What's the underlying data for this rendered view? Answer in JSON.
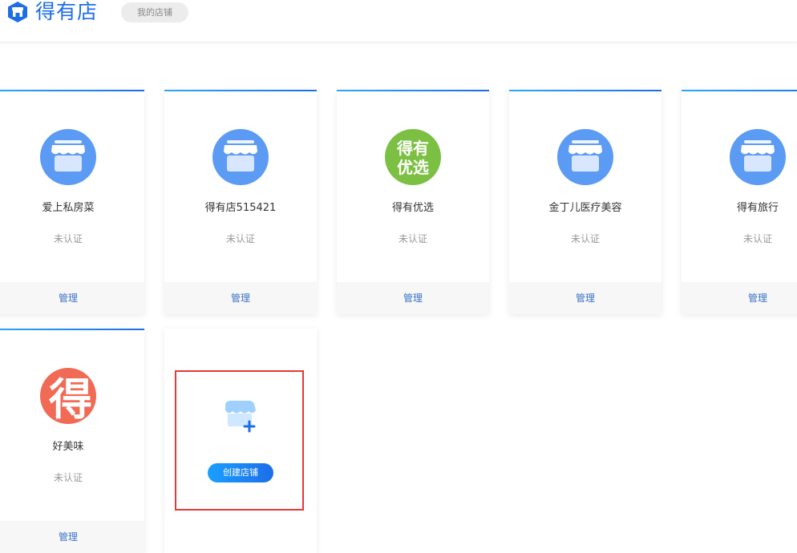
{
  "header": {
    "logo_text": "得有店",
    "my_shops_label": "我的店铺"
  },
  "colors": {
    "brand_blue": "#1d6de8",
    "avatar_blue": "#5b9bf3",
    "avatar_green": "#7cc043",
    "avatar_red": "#f06a55",
    "highlight_red": "#e53935"
  },
  "shops": [
    {
      "name": "爱上私房菜",
      "status": "未认证",
      "manage_label": "管理",
      "avatar": {
        "type": "store-icon",
        "color": "#5b9bf3"
      }
    },
    {
      "name": "得有店515421",
      "status": "未认证",
      "manage_label": "管理",
      "avatar": {
        "type": "store-icon",
        "color": "#5b9bf3"
      }
    },
    {
      "name": "得有优选",
      "status": "未认证",
      "manage_label": "管理",
      "avatar": {
        "type": "text-logo",
        "color": "#7cc043",
        "line1": "得有",
        "line2": "优选"
      }
    },
    {
      "name": "金丁儿医疗美容",
      "status": "未认证",
      "manage_label": "管理",
      "avatar": {
        "type": "store-icon",
        "color": "#5b9bf3"
      }
    },
    {
      "name": "得有旅行",
      "status": "未认证",
      "manage_label": "管理",
      "avatar": {
        "type": "store-icon",
        "color": "#5b9bf3"
      }
    },
    {
      "name": "好美味",
      "status": "未认证",
      "manage_label": "管理",
      "avatar": {
        "type": "char-logo",
        "color": "#f06a55",
        "char": "得"
      }
    }
  ],
  "create": {
    "button_label": "创建店铺",
    "icon": "store-add-icon"
  }
}
